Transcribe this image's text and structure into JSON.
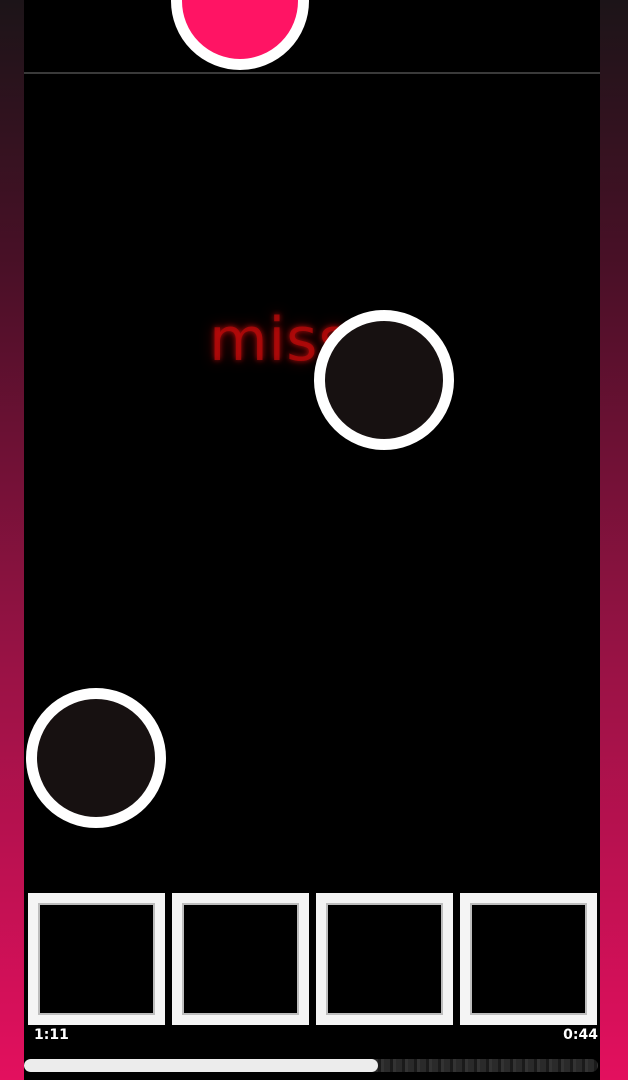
{
  "game": {
    "judgement_text": "miss...",
    "elapsed_time": "1:11",
    "remaining_time": "0:44",
    "progress_fraction": 0.617,
    "lanes": [
      "lane-1",
      "lane-2",
      "lane-3",
      "lane-4"
    ]
  },
  "colors": {
    "background": "#000000",
    "accent_pink": "#ff1464",
    "note_fill": "#171111",
    "note_ring": "#ffffff",
    "miss_red": "#be0a0a"
  },
  "icons": {
    "note": "circle-note-icon",
    "active_note": "filled-circle-note-icon"
  }
}
